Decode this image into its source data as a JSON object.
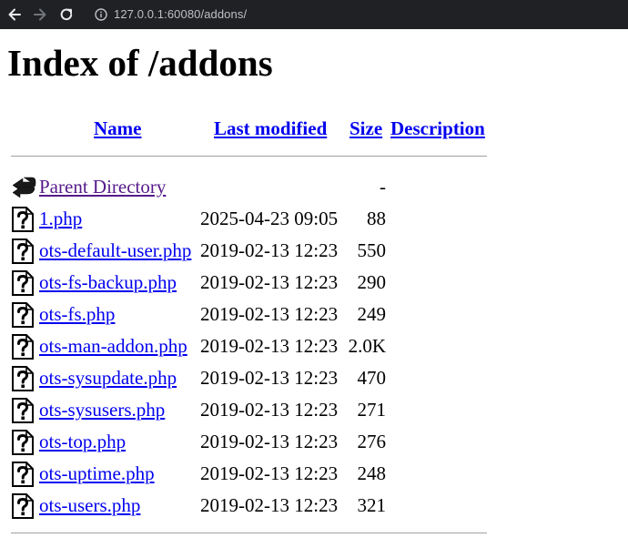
{
  "browser": {
    "url": "127.0.0.1:60080/addons/"
  },
  "page": {
    "title": "Index of /addons"
  },
  "table": {
    "headers": {
      "name": "Name",
      "last_modified": "Last modified",
      "size": "Size",
      "description": "Description"
    },
    "parent": {
      "name": "Parent Directory",
      "size": "-",
      "icon": "back-arrow-icon"
    },
    "files": [
      {
        "name": "1.php",
        "date": "2025-04-23 09:05",
        "size": "88",
        "icon": "unknown-file-icon"
      },
      {
        "name": "ots-default-user.php",
        "date": "2019-02-13 12:23",
        "size": "550",
        "icon": "unknown-file-icon"
      },
      {
        "name": "ots-fs-backup.php",
        "date": "2019-02-13 12:23",
        "size": "290",
        "icon": "unknown-file-icon"
      },
      {
        "name": "ots-fs.php",
        "date": "2019-02-13 12:23",
        "size": "249",
        "icon": "unknown-file-icon"
      },
      {
        "name": "ots-man-addon.php",
        "date": "2019-02-13 12:23",
        "size": "2.0K",
        "icon": "unknown-file-icon"
      },
      {
        "name": "ots-sysupdate.php",
        "date": "2019-02-13 12:23",
        "size": "470",
        "icon": "unknown-file-icon"
      },
      {
        "name": "ots-sysusers.php",
        "date": "2019-02-13 12:23",
        "size": "271",
        "icon": "unknown-file-icon"
      },
      {
        "name": "ots-top.php",
        "date": "2019-02-13 12:23",
        "size": "276",
        "icon": "unknown-file-icon"
      },
      {
        "name": "ots-uptime.php",
        "date": "2019-02-13 12:23",
        "size": "248",
        "icon": "unknown-file-icon"
      },
      {
        "name": "ots-users.php",
        "date": "2019-02-13 12:23",
        "size": "321",
        "icon": "unknown-file-icon"
      }
    ]
  }
}
